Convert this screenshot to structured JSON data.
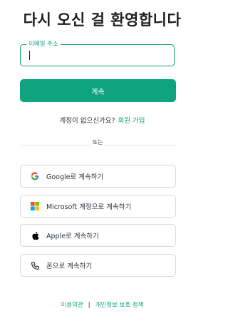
{
  "header": {
    "title": "다시 오신 걸 환영합니다"
  },
  "email": {
    "label": "이메일 주소",
    "value": ""
  },
  "continue_button": {
    "label": "계속"
  },
  "signup": {
    "prompt": "계정이 없으신가요?",
    "link": "회원 가입"
  },
  "divider": {
    "text": "또는"
  },
  "social_buttons": [
    {
      "icon": "google-icon",
      "label": "Google로 계속하기"
    },
    {
      "icon": "microsoft-icon",
      "label": "Microsoft 계정으로 계속하기"
    },
    {
      "icon": "apple-icon",
      "label": "Apple로 계속하기"
    },
    {
      "icon": "phone-icon",
      "label": "폰으로 계속하기"
    }
  ],
  "footer": {
    "terms": "이용약관",
    "separator": "|",
    "privacy": "개인정보 보호 정책"
  },
  "colors": {
    "accent": "#10a37f",
    "border": "#d9d9e3",
    "text": "#2d333a"
  }
}
